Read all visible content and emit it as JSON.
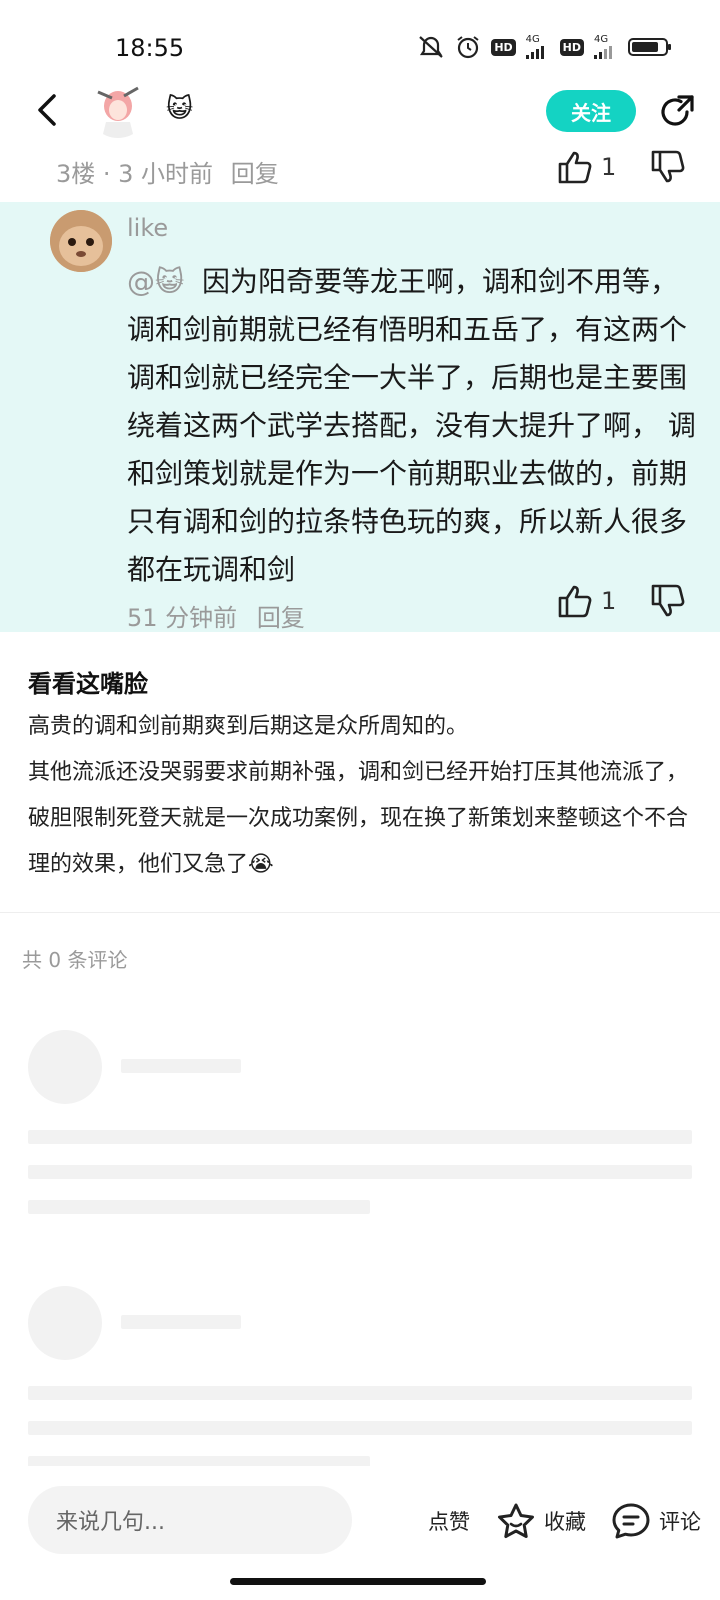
{
  "status_bar": {
    "time": "18:55",
    "network": [
      "4G",
      "4G"
    ],
    "hd": [
      "HD",
      "HD"
    ]
  },
  "header": {
    "cat_emoji": "😺",
    "follow_label": "关注",
    "accent": "#14d3c3"
  },
  "floor": {
    "meta": "3楼 · 3 小时前",
    "reply_label": "回复",
    "like_count": "1"
  },
  "quoted_reply": {
    "author": "like",
    "mention": "@😺",
    "text": "因为阳奇要等龙王啊，调和剑不用等，调和剑前期就已经有悟明和五岳了，有这两个调和剑就已经完全一大半了，后期也是主要围绕着这两个武学去搭配，没有大提升了啊， 调和剑策划就是作为一个前期职业去做的，前期只有调和剑的拉条特色玩的爽，所以新人很多都在玩调和剑",
    "time": "51 分钟前",
    "reply_label": "回复",
    "like_count": "1",
    "bg": "#e4f8f6"
  },
  "post": {
    "title": "看看这嘴脸",
    "paragraph1": "高贵的调和剑前期爽到后期这是众所周知的。",
    "paragraph2": "其他流派还没哭弱要求前期补强，调和剑已经开始打压其他流派了，破胆限制死登天就是一次成功案例，现在换了新策划来整顿这个不合理的效果，他们又急了😭"
  },
  "comments": {
    "count_text": "共 0 条评论"
  },
  "bottom_bar": {
    "input_placeholder": "来说几句...",
    "like_label": "点赞",
    "favorite_label": "收藏",
    "comment_label": "评论"
  }
}
